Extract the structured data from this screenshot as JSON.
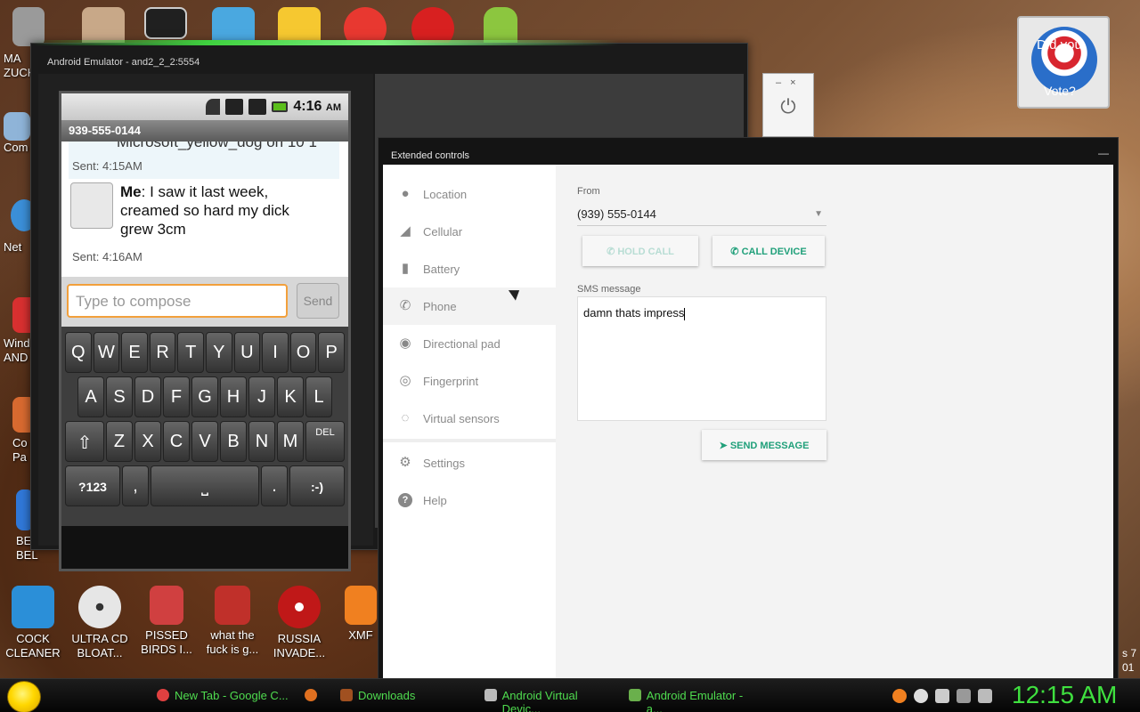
{
  "desktop": {
    "icons_left": [
      {
        "label": "MA\nZUCK",
        "color": "#d8d8d8"
      },
      {
        "label": "Com",
        "color": "#8fb4d8"
      },
      {
        "label": "Net",
        "color": "#3b8fd8"
      },
      {
        "label": "Wind\nAND",
        "color": "#d83030"
      },
      {
        "label": "Co\nPa",
        "color": "#d86a30"
      },
      {
        "label": "BE\nBEL",
        "color": "#3078d8"
      }
    ],
    "icons_bottom": [
      {
        "label": "COCK CLEANER",
        "color": "#2b8fd8"
      },
      {
        "label": "ULTRA CD BLOAT...",
        "color": "#e6e6e6"
      },
      {
        "label": "PISSED BIRDS I...",
        "color": "#d04040"
      },
      {
        "label": "what the fuck is g...",
        "color": "#c0302a"
      },
      {
        "label": "RUSSIA INVADE...",
        "color": "#c01818"
      },
      {
        "label": "XMF",
        "color": "#f08020"
      }
    ],
    "icons_top": [
      {
        "color": "#9a9a9a"
      },
      {
        "color": "#c8a888"
      },
      {
        "color": "#202020"
      },
      {
        "color": "#4aa8e0"
      },
      {
        "color": "#f6c830"
      },
      {
        "color": "#e83830"
      },
      {
        "color": "#d82020"
      },
      {
        "color": "#8cc63f"
      }
    ],
    "obama_tile": {
      "line1": "Did you",
      "line2": "Vote?"
    },
    "edge_text": {
      "line1": "s 7",
      "line2": "01"
    }
  },
  "emulator": {
    "title": "Android Emulator - and2_2_2:5554",
    "status_time": "4:16",
    "status_ampm": "AM",
    "contact": "939-555-0144",
    "cutoff_text": "Microsoft_yellow_dog on 10 1",
    "sent_1": "Sent: 4:15AM",
    "message_sender": "Me",
    "message_body": ": I saw it last week, creamed so hard my dick grew 3cm",
    "sent_2": "Sent: 4:16AM",
    "compose_placeholder": "Type to compose",
    "send_label": "Send",
    "keyboard": {
      "row1": [
        "Q",
        "W",
        "E",
        "R",
        "T",
        "Y",
        "U",
        "I",
        "O",
        "P"
      ],
      "row2": [
        "A",
        "S",
        "D",
        "F",
        "G",
        "H",
        "J",
        "K",
        "L"
      ],
      "row3": [
        "Z",
        "X",
        "C",
        "V",
        "B",
        "N",
        "M"
      ],
      "shift_label": "⇧",
      "del_label": "DEL",
      "sym_label": "?123",
      "comma_label": ",",
      "space_label": "⎵",
      "period_label": ".",
      "smiley_label": ":-)"
    }
  },
  "power_popup": {
    "minimize": "–",
    "close": "×",
    "power": "⏻"
  },
  "extended_controls": {
    "title": "Extended controls",
    "minimize": "—",
    "nav": [
      {
        "label": "Location",
        "icon": "location-pin-icon",
        "glyph": "📍"
      },
      {
        "label": "Cellular",
        "icon": "cellular-signal-icon",
        "glyph": "◢"
      },
      {
        "label": "Battery",
        "icon": "battery-icon",
        "glyph": "▮"
      },
      {
        "label": "Phone",
        "icon": "phone-icon",
        "glyph": "✆"
      },
      {
        "label": "Directional pad",
        "icon": "dpad-icon",
        "glyph": "◉"
      },
      {
        "label": "Fingerprint",
        "icon": "fingerprint-icon",
        "glyph": "◎"
      },
      {
        "label": "Virtual sensors",
        "icon": "virtual-sensors-icon",
        "glyph": "◌"
      },
      {
        "label": "Settings",
        "icon": "gear-icon",
        "glyph": "⚙"
      },
      {
        "label": "Help",
        "icon": "help-icon",
        "glyph": "?"
      }
    ],
    "active_nav": "Phone",
    "from_label": "From",
    "from_value": "(939) 555-0144",
    "hold_call_label": "HOLD CALL",
    "call_device_label": "CALL DEVICE",
    "sms_label": "SMS message",
    "sms_value": "damn thats impress",
    "send_message_label": "SEND MESSAGE",
    "accent_color": "#20a07a"
  },
  "taskbar": {
    "tasks": [
      {
        "label": "New Tab - Google C...",
        "icon_color": "#e04040"
      },
      {
        "label": "Downloads",
        "icon_color": "#a05020"
      },
      {
        "label": "Android Virtual Devic...",
        "icon_color": "#bbbbbb"
      },
      {
        "label": "Android Emulator - a...",
        "icon_color": "#6ab04c"
      }
    ],
    "clock": "12:15 AM",
    "text_color": "#4fdc4f"
  }
}
